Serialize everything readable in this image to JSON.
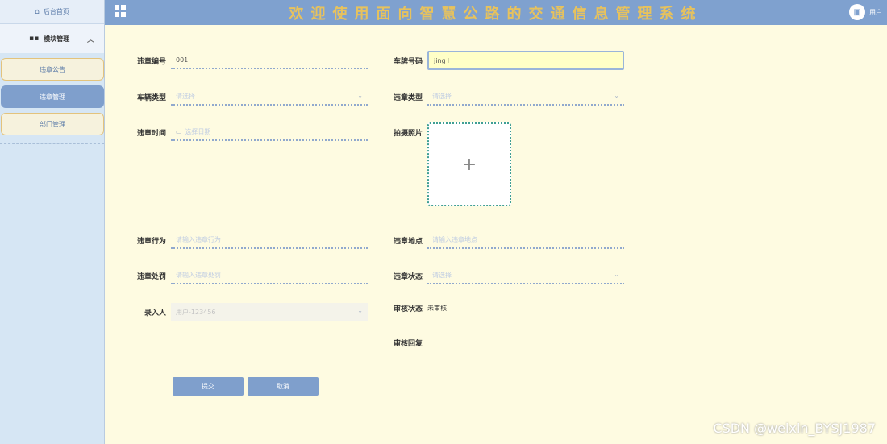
{
  "sidebar": {
    "home_label": "后台首页",
    "module_label": "模块管理",
    "items": [
      {
        "label": "违章公告",
        "active": false
      },
      {
        "label": "违章管理",
        "active": true
      },
      {
        "label": "部门管理",
        "active": false
      }
    ]
  },
  "header": {
    "title": "欢迎使用面向智慧公路的交通信息管理系统",
    "user_label": "用户"
  },
  "form": {
    "violation_no": {
      "label": "违章编号",
      "value": "001"
    },
    "plate_no": {
      "label": "车牌号码",
      "value": "jing"
    },
    "vehicle_type": {
      "label": "车辆类型",
      "placeholder": "请选择"
    },
    "violation_type": {
      "label": "违章类型",
      "placeholder": "请选择"
    },
    "violation_time": {
      "label": "违章时间",
      "placeholder": "选择日期"
    },
    "photo": {
      "label": "拍摄照片"
    },
    "violation_act": {
      "label": "违章行为",
      "placeholder": "请输入违章行为"
    },
    "violation_place": {
      "label": "违章地点",
      "placeholder": "请输入违章地点"
    },
    "violation_penalty": {
      "label": "违章处罚",
      "placeholder": "请输入违章处罚"
    },
    "violation_status": {
      "label": "违章状态",
      "placeholder": "请选择"
    },
    "recorder": {
      "label": "录入人",
      "value": "用户-123456"
    },
    "review_status": {
      "label": "审核状态",
      "value": "未审核"
    },
    "review_reply": {
      "label": "审核回复"
    }
  },
  "buttons": {
    "submit": "提交",
    "cancel": "取消"
  },
  "watermark": "CSDN @weixin_BYSJ1987",
  "colors": {
    "header": "#7fa1cf",
    "sidebar": "#d6e6f4",
    "background": "#fefbe1",
    "accent": "#7f9fcc"
  }
}
